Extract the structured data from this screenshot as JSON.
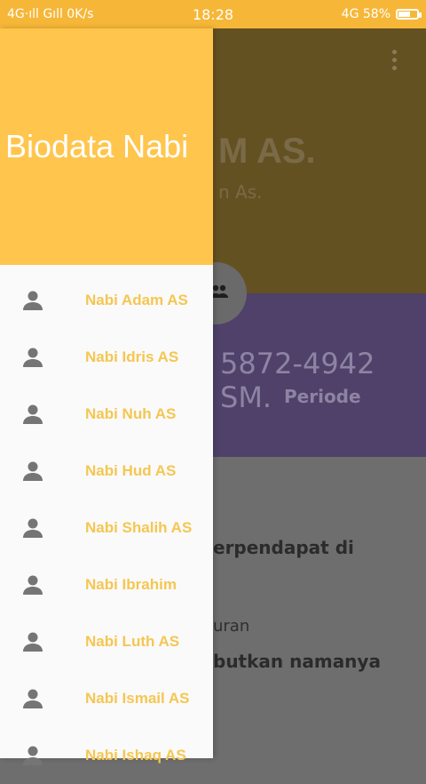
{
  "status_bar": {
    "left": "4G·ıll Gıll 0K/s",
    "time": "18:28",
    "right": "4G 58%"
  },
  "background_app": {
    "title": "M AS.",
    "subtitle": "n As.",
    "period_value": "5872-4942 SM.",
    "period_label": "Periode",
    "line1": "erpendapat di",
    "line2": "uran",
    "line3": "butkan namanya"
  },
  "drawer": {
    "title": "Biodata Nabi",
    "items": [
      {
        "label": "Nabi Adam AS"
      },
      {
        "label": "Nabi Idris AS"
      },
      {
        "label": "Nabi Nuh AS"
      },
      {
        "label": "Nabi Hud AS"
      },
      {
        "label": "Nabi Shalih AS"
      },
      {
        "label": "Nabi Ibrahim"
      },
      {
        "label": "Nabi Luth AS"
      },
      {
        "label": "Nabi Ismail AS"
      },
      {
        "label": "Nabi Ishaq AS"
      }
    ]
  },
  "colors": {
    "accent": "#ffc54d",
    "status_bar": "#f6b738",
    "label": "#f5c651"
  },
  "icons": {
    "nav_item": "person-icon",
    "fab": "people-icon",
    "overflow": "more-vert-icon",
    "battery": "battery-icon"
  }
}
